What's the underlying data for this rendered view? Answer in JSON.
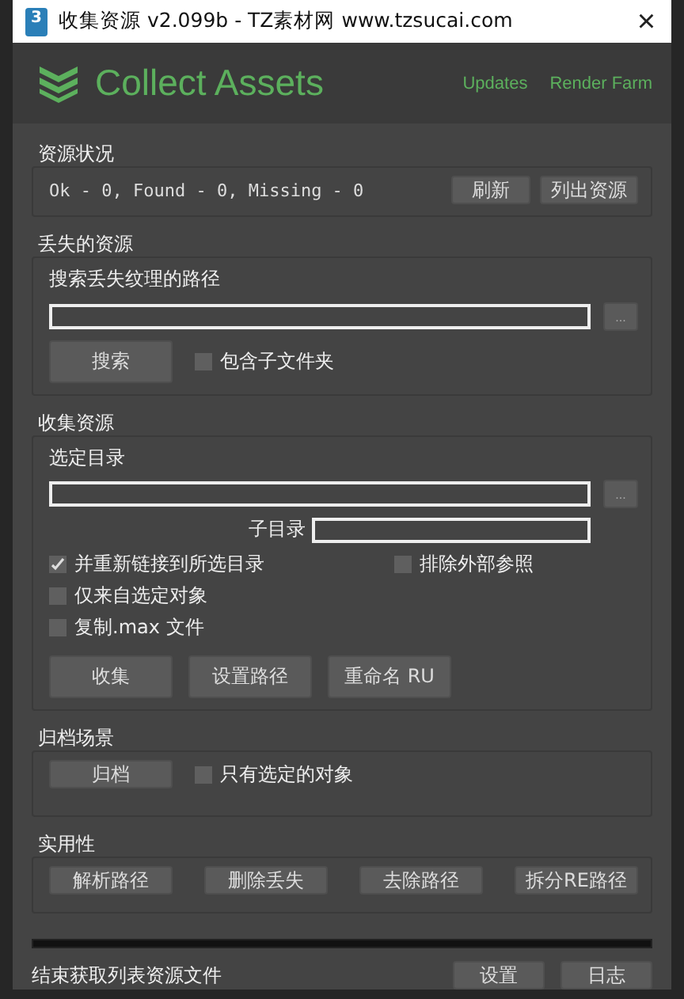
{
  "window": {
    "title": "收集资源 v2.099b - TZ素材网 www.tzsucai.com",
    "icon_label": "3",
    "close": "×"
  },
  "header": {
    "brand": "Collect Assets",
    "links": [
      "Updates",
      "Render Farm"
    ]
  },
  "asset_status": {
    "title": "资源状况",
    "status": "Ok - 0, Found - 0, Missing - 0",
    "buttons": [
      "刷新",
      "列出资源"
    ]
  },
  "missing_assets": {
    "title": "丢失的资源",
    "path_label": "搜索丢失纹理的路径",
    "browse": "...",
    "search_button": "搜索",
    "options": [
      {
        "label": "包含子文件夹",
        "checked": false
      }
    ]
  },
  "collect_assets": {
    "title": "收集资源",
    "dir_label": "选定目录",
    "browse": "...",
    "subdir_label": "子目录",
    "options_left": [
      {
        "label": "并重新链接到所选目录",
        "checked": true
      },
      {
        "label": "仅来自选定对象",
        "checked": false
      },
      {
        "label": "复制.max 文件",
        "checked": false
      }
    ],
    "options_right": [
      {
        "label": "排除外部参照",
        "checked": false
      }
    ],
    "buttons": [
      "收集",
      "设置路径",
      "重命名 RU"
    ]
  },
  "archive_scene": {
    "title": "归档场景",
    "button": "归档",
    "options": [
      {
        "label": "只有选定的对象",
        "checked": false
      }
    ]
  },
  "utilities": {
    "title": "实用性",
    "buttons": [
      "解析路径",
      "删除丢失",
      "去除路径",
      "拆分RE路径"
    ]
  },
  "progress": {
    "level": 0
  },
  "status_bar": {
    "text": "结束获取列表资源文件",
    "buttons": [
      "设置",
      "日志"
    ]
  }
}
